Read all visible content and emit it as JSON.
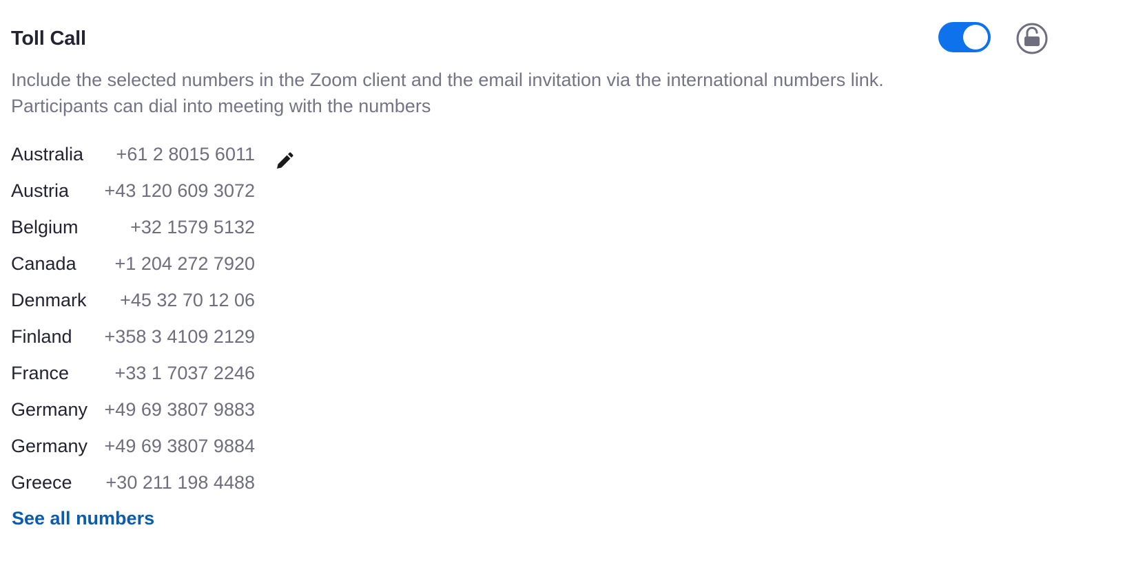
{
  "setting": {
    "title": "Toll Call",
    "description_line1": "Include the selected numbers in the Zoom client and the email invitation via the international numbers link.",
    "description_line2": "Participants can dial into meeting with the numbers",
    "toggle_state": "on",
    "lock_state": "unlocked"
  },
  "numbers": [
    {
      "country": "Australia",
      "phone": "+61 2 8015 6011"
    },
    {
      "country": "Austria",
      "phone": "+43 120 609 3072"
    },
    {
      "country": "Belgium",
      "phone": "+32 1579 5132"
    },
    {
      "country": "Canada",
      "phone": "+1 204 272 7920"
    },
    {
      "country": "Denmark",
      "phone": "+45 32 70 12 06"
    },
    {
      "country": "Finland",
      "phone": "+358 3 4109 2129"
    },
    {
      "country": "France",
      "phone": "+33 1 7037 2246"
    },
    {
      "country": "Germany",
      "phone": "+49 69 3807 9883"
    },
    {
      "country": "Germany",
      "phone": "+49 69 3807 9884"
    },
    {
      "country": "Greece",
      "phone": "+30 211 198 4488"
    }
  ],
  "links": {
    "see_all": "See all numbers"
  },
  "icons": {
    "edit": "pencil-icon",
    "lock": "unlocked-padlock-icon"
  },
  "colors": {
    "toggle_on": "#0e72ed",
    "link": "#0b5cad",
    "title": "#232333",
    "secondary_text": "#747487",
    "lock_icon": "#6e6e7e"
  }
}
